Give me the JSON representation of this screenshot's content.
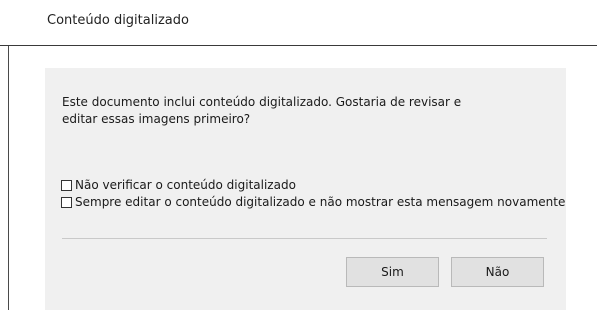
{
  "dialog": {
    "title": "Conteúdo digitalizado",
    "message_line1": "Este documento inclui conteúdo digitalizado. Gostaria de revisar e",
    "message_line2": "editar essas imagens primeiro?",
    "checkboxes": [
      {
        "label": "Não verificar o conteúdo digitalizado",
        "checked": false
      },
      {
        "label": "Sempre editar o conteúdo digitalizado e não mostrar esta mensagem novamente",
        "checked": false
      }
    ],
    "buttons": {
      "yes_label": "Sim",
      "no_label": "Não"
    }
  },
  "colors": {
    "panel_background": "#f0f0f0",
    "button_background": "#e1e1e1",
    "button_border": "#b9b9b9",
    "text": "#1a1a1a"
  }
}
